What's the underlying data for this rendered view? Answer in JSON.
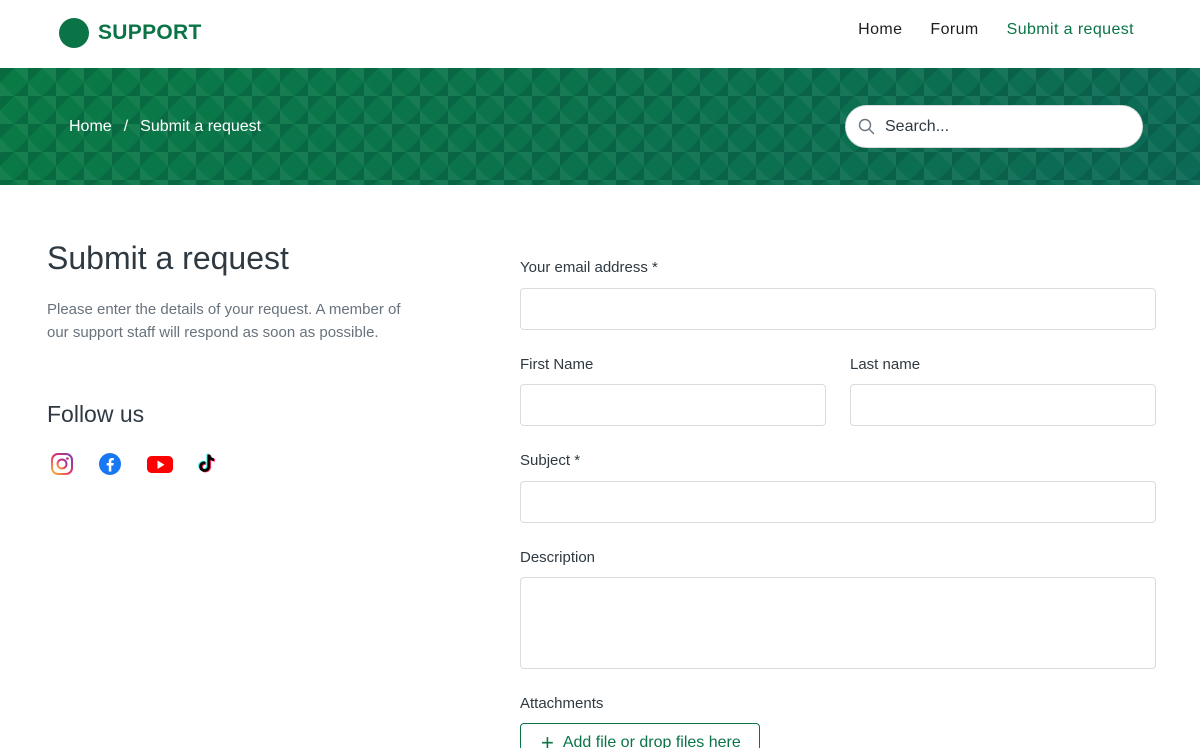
{
  "header": {
    "logo_text": "SUPPORT",
    "brand_color": "#0a7446",
    "nav": [
      {
        "label": "Home"
      },
      {
        "label": "Forum"
      },
      {
        "label": "Submit a request"
      }
    ]
  },
  "hero": {
    "breadcrumb": [
      {
        "label": "Home"
      },
      {
        "label": "/"
      },
      {
        "label": "Submit a request"
      }
    ],
    "search": {
      "placeholder": "Search...",
      "icon": "search-icon"
    }
  },
  "sidebar": {
    "title": "Submit a request",
    "intro": "Please enter the details of your request. A member of our support staff will respond as soon as possible.",
    "follow_title": "Follow us",
    "socials": [
      {
        "icon": "instagram-icon"
      },
      {
        "icon": "facebook-icon"
      },
      {
        "icon": "youtube-icon"
      },
      {
        "icon": "tiktok-icon"
      }
    ]
  },
  "form": {
    "email_label": "Your email address *",
    "email_value": "",
    "first_name_label": "First Name",
    "first_name_value": "",
    "last_name_label": "Last name",
    "last_name_value": "",
    "subject_label": "Subject *",
    "subject_value": "",
    "description_label": "Description",
    "description_value": "",
    "attachments_label": "Attachments",
    "attach_button": "Add file or drop files here"
  }
}
